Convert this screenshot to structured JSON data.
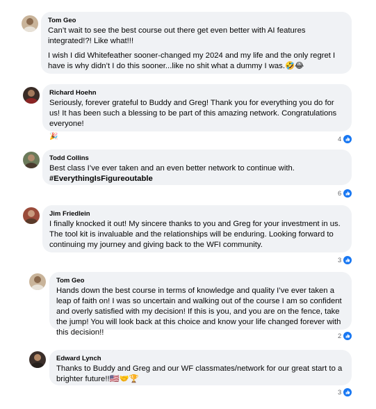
{
  "comments": [
    {
      "author": "Tom Geo",
      "text1": "Can’t wait to see the best course out there get even better with AI features integrated!?! Like what!!!",
      "text2": "I wish I did Whitefeather sooner-changed my 2024 and my life and the only regret I have is why didn’t I do this sooner...like no shit what a dummy I was.🤣😂",
      "avatar_icon": "profile-avatar"
    },
    {
      "author": "Richard Hoehn",
      "text1": "Seriously, forever grateful to Buddy and Greg! Thank you for everything you do for us! It has been such a blessing to be part of this amazing network. Congratulations everyone!",
      "emoji": "🎉",
      "reactions": "4",
      "avatar_icon": "profile-avatar"
    },
    {
      "author": "Todd Collins",
      "text1": "Best class I’ve ever taken and an even better network to continue with.",
      "hashtag": "#EverythingIsFigureoutable",
      "reactions": "6",
      "avatar_icon": "profile-avatar"
    },
    {
      "author": "Jim Friedlein",
      "text1": "I finally knocked it out! My sincere thanks to you and Greg for your investment in us. The tool kit is invaluable and the relationships will be enduring. Looking forward to continuing my journey and giving back to the WFI community.",
      "reactions": "3",
      "avatar_icon": "profile-avatar"
    },
    {
      "author": "Tom Geo",
      "text1": "Hands down the best course in terms of knowledge and quality I’ve ever taken a leap of faith on! I was so uncertain and walking out of the course I am so confident and overly satisfied with my decision! If this is you, and you are on the fence, take the jump! You will look back at this choice and know your life changed forever with this decision!!",
      "reactions": "2",
      "avatar_icon": "profile-avatar"
    },
    {
      "author": "Edward Lynch",
      "text1": "Thanks to Buddy and Greg and our WF classmates/network for our great start to a brighter future!!🇺🇸🤝🏆",
      "reactions": "3",
      "avatar_icon": "profile-avatar"
    }
  ],
  "colors": {
    "bubble": "#f0f2f5",
    "like": "#1877f2",
    "meta": "#65676b",
    "text": "#050505"
  },
  "icons": {
    "reaction": "like-thumb-icon"
  }
}
